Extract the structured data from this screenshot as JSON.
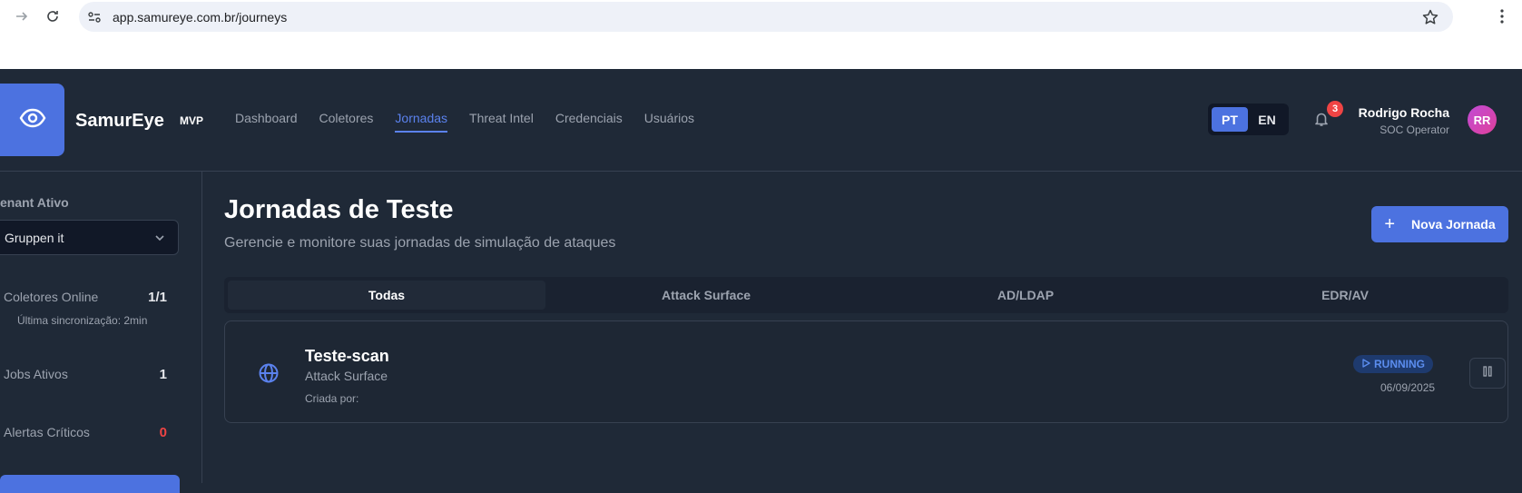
{
  "browser": {
    "url": "app.samureye.com.br/journeys",
    "icons": [
      "forward-icon",
      "reload-icon",
      "site-settings-icon",
      "star-icon",
      "menu-icon"
    ]
  },
  "header": {
    "brand": "SamurEye",
    "badge": "MVP",
    "nav": [
      {
        "label": "Dashboard",
        "active": false
      },
      {
        "label": "Coletores",
        "active": false
      },
      {
        "label": "Jornadas",
        "active": true
      },
      {
        "label": "Threat Intel",
        "active": false
      },
      {
        "label": "Credenciais",
        "active": false
      },
      {
        "label": "Usuários",
        "active": false
      }
    ],
    "lang": {
      "pt": "PT",
      "en": "EN",
      "selected": "PT"
    },
    "notifications_count": "3",
    "user": {
      "name": "Rodrigo Rocha",
      "role": "SOC Operator",
      "initials": "RR"
    }
  },
  "sidebar": {
    "tenant_label": "enant Ativo",
    "tenant_value": "Gruppen it",
    "stats": {
      "collectors_label": "Coletores Online",
      "collectors_value": "1/1",
      "last_sync": "Última sincronização: 2min",
      "jobs_label": "Jobs Ativos",
      "jobs_value": "1",
      "alerts_label": "Alertas Críticos",
      "alerts_value": "0"
    }
  },
  "main": {
    "title": "Jornadas de Teste",
    "subtitle": "Gerencie e monitore suas jornadas de simulação de ataques",
    "new_button": "Nova Jornada",
    "tabs": [
      {
        "label": "Todas",
        "active": true
      },
      {
        "label": "Attack Surface",
        "active": false
      },
      {
        "label": "AD/LDAP",
        "active": false
      },
      {
        "label": "EDR/AV",
        "active": false
      }
    ],
    "journeys": [
      {
        "title": "Teste-scan",
        "type": "Attack Surface",
        "created_by": "Criada por:",
        "status": "RUNNING",
        "date": "06/09/2025"
      }
    ]
  },
  "colors": {
    "accent": "#4c72e0",
    "background": "#1f2937",
    "danger": "#ef4444"
  }
}
